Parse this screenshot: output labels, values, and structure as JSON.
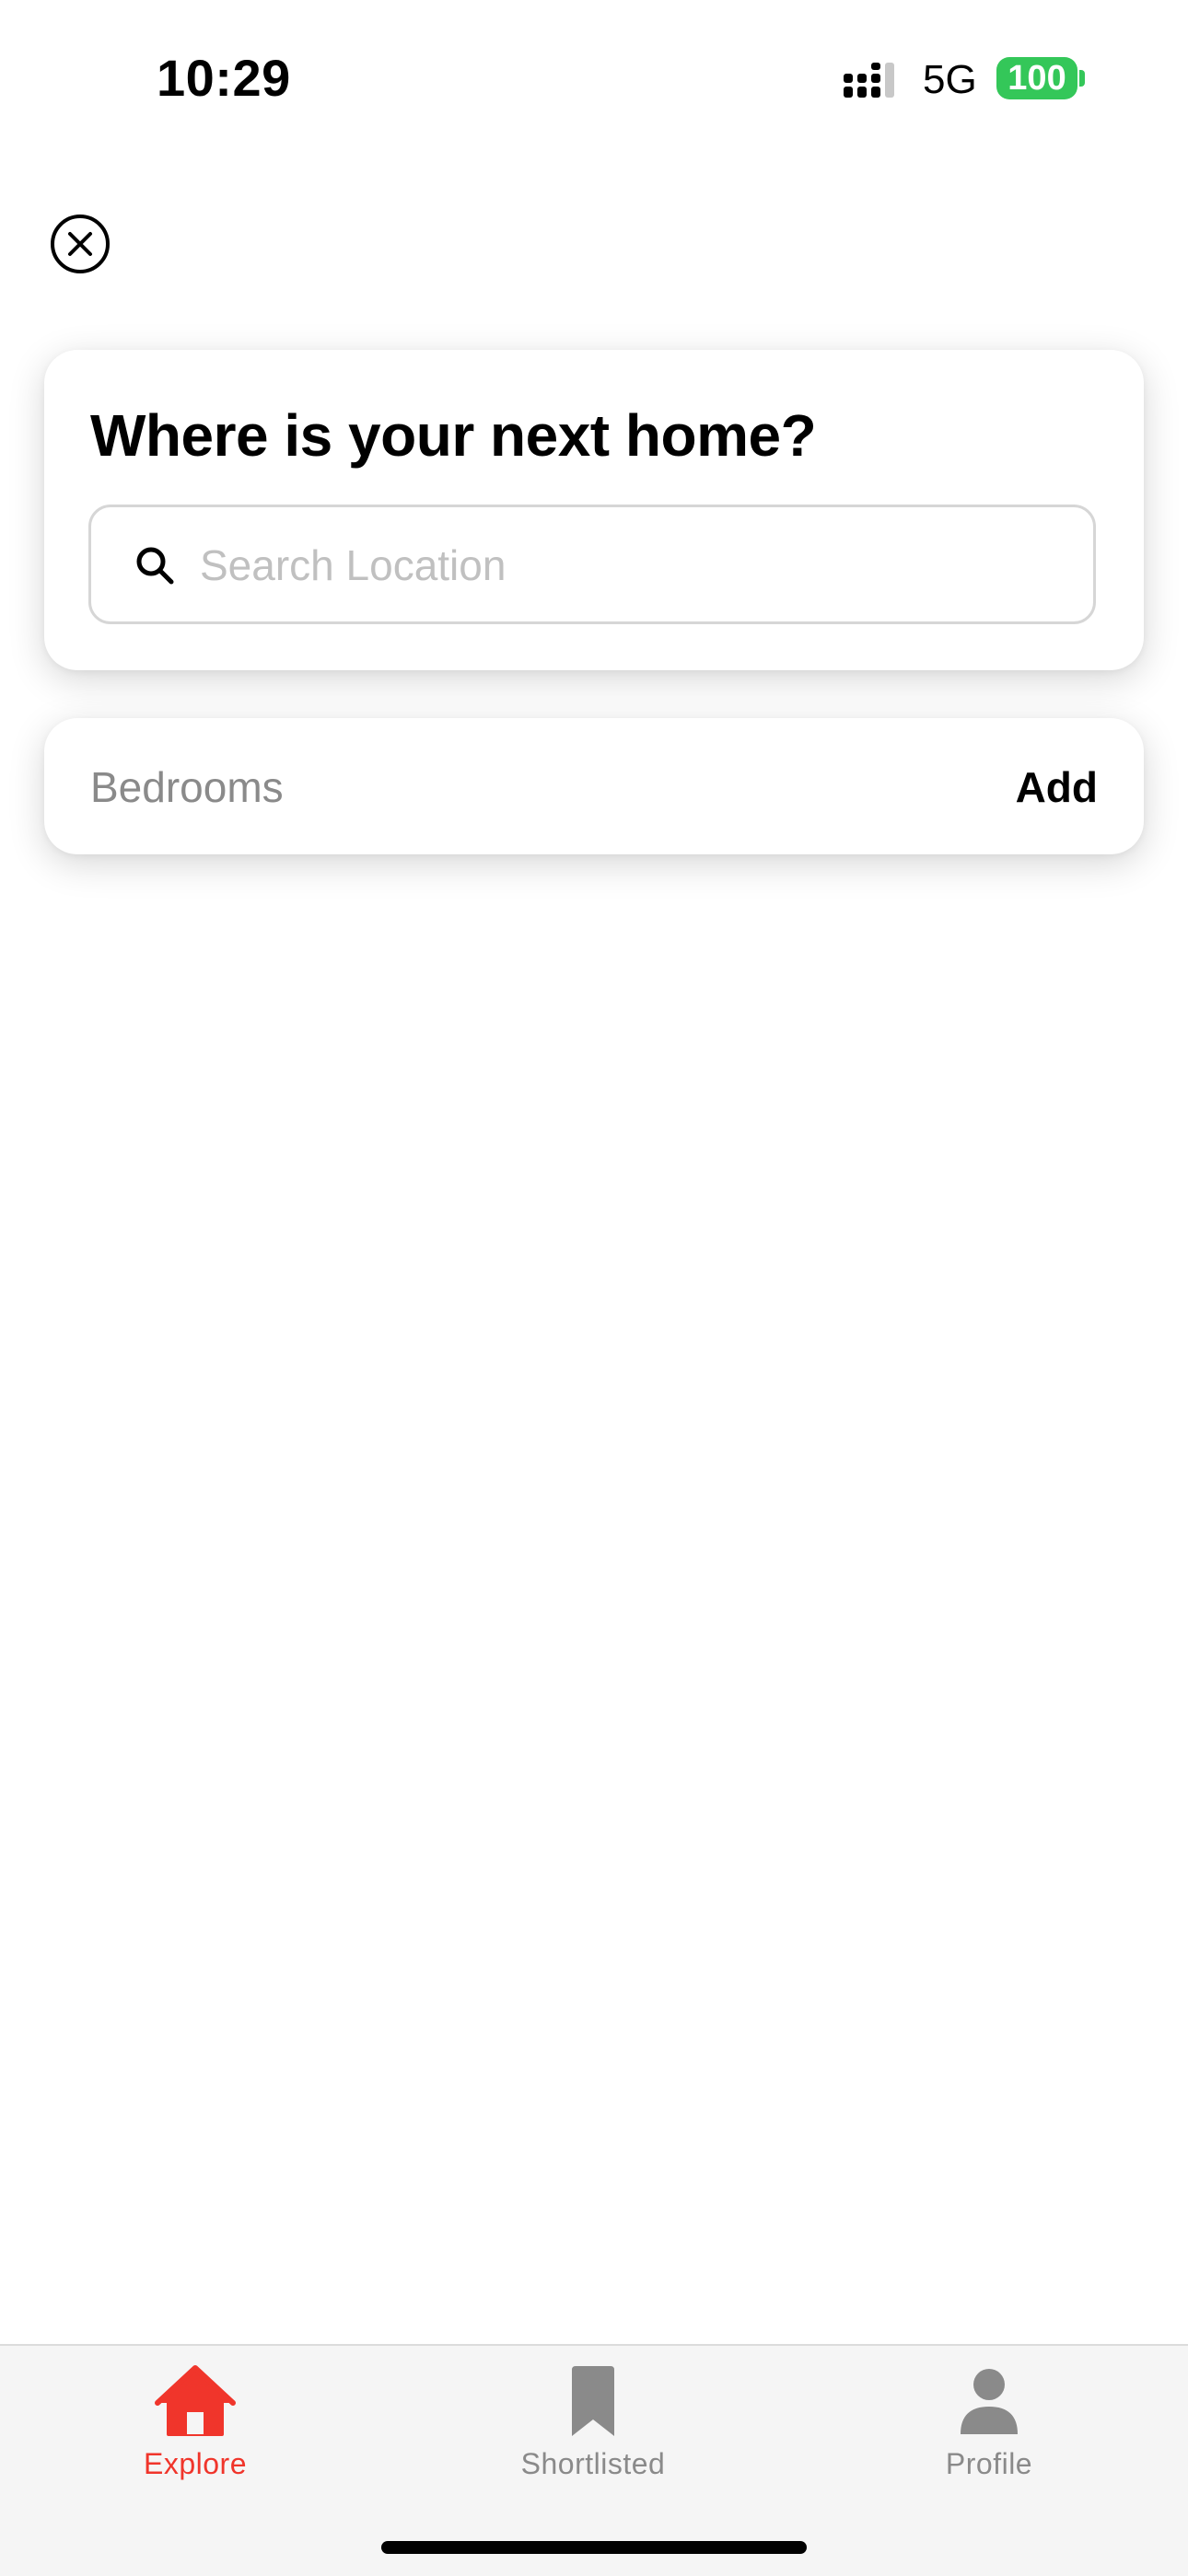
{
  "status_bar": {
    "time": "10:29",
    "network": "5G",
    "battery": "100",
    "battery_color": "#34c759"
  },
  "close_icon": "close-circle-icon",
  "search_card": {
    "title": "Where is your next home?",
    "search_placeholder": "Search Location",
    "search_value": "",
    "search_icon": "search-icon"
  },
  "bedrooms_card": {
    "label": "Bedrooms",
    "action": "Add"
  },
  "tab_bar": {
    "accent_color": "#f0352b",
    "inactive_color": "#8a8a8a",
    "tabs": [
      {
        "label": "Explore",
        "icon": "home-icon",
        "active": true
      },
      {
        "label": "Shortlisted",
        "icon": "bookmark-icon",
        "active": false
      },
      {
        "label": "Profile",
        "icon": "person-icon",
        "active": false
      }
    ]
  }
}
